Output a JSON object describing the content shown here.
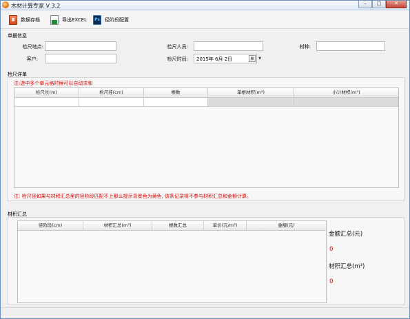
{
  "window": {
    "title": "木材计算专家 V 3.2",
    "controls": {
      "minimize": "–",
      "maximize": "□",
      "close": "✕"
    }
  },
  "toolbar": {
    "items": [
      {
        "label": "数据存档",
        "icon": "save-archive-icon"
      },
      {
        "label": "导出EXCEL",
        "icon": "excel-export-icon"
      },
      {
        "label": "径阶段配置",
        "icon": "photoshop-config-icon",
        "glyph": "Ps"
      }
    ]
  },
  "doc_info": {
    "group_label": "单据信息",
    "fields": {
      "location_label": "检尺地点:",
      "location_value": "",
      "inspector_label": "检尺人员:",
      "inspector_value": "",
      "species_label": "材种:",
      "species_value": "",
      "customer_label": "客户:",
      "customer_value": "",
      "time_label": "检尺时间:",
      "time_value": "2015年 6月 2日"
    }
  },
  "detail": {
    "group_label": "检尺详单",
    "tip": "注:选中多个单元格时候可以自动求和",
    "columns": [
      "检尺长(m)",
      "检尺径(cm)",
      "根数",
      "单根材积(m³)",
      "小计材积(m³)"
    ],
    "warning": "注: 检尺径如果与材积汇总里的径阶段匹配不上那么提示背景色为黄色, 该条记录将不参与材积汇总和金额计算。"
  },
  "summary": {
    "group_label": "材积汇总",
    "columns": [
      "径阶段(cm)",
      "材积汇总(m³)",
      "根数汇总",
      "单价(元/m³)",
      "金额(元)"
    ],
    "amount_label": "金额汇总(元)",
    "amount_value": "0",
    "volume_label": "材积汇总(m³)",
    "volume_value": "0"
  },
  "colors": {
    "accent_red": "#e00000",
    "window_border": "#6b8fbf",
    "readonly_cell": "#dcdcdc"
  }
}
